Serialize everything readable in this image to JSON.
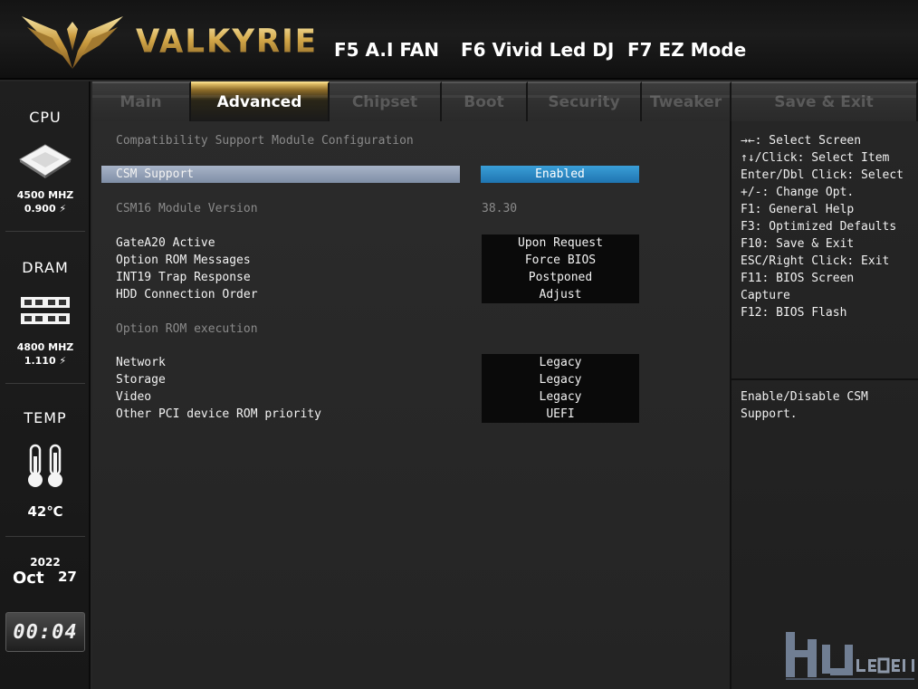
{
  "header": {
    "brand": "VALKYRIE",
    "hotkeys": {
      "f5": "F5 A.I FAN",
      "f6": "F6 Vivid Led DJ",
      "f7": "F7 EZ Mode"
    }
  },
  "sidebar": {
    "cpu": {
      "title": "CPU",
      "freq": "4500 MHZ",
      "volt": "0.900 ⚡"
    },
    "dram": {
      "title": "DRAM",
      "freq": "4800 MHZ",
      "volt": "1.110 ⚡"
    },
    "temp": {
      "title": "TEMP",
      "value": "42℃"
    },
    "date": {
      "year": "2022",
      "month": "Oct",
      "day": "27"
    },
    "time": "00:04"
  },
  "tabs": [
    {
      "label": "Main",
      "active": false
    },
    {
      "label": "Advanced",
      "active": true
    },
    {
      "label": "Chipset",
      "active": false
    },
    {
      "label": "Boot",
      "active": false
    },
    {
      "label": "Security",
      "active": false
    },
    {
      "label": "Tweaker",
      "active": false
    },
    {
      "label": "Save & Exit",
      "active": false
    }
  ],
  "main": {
    "section_title": "Compatibility Support Module Configuration",
    "csm_support": {
      "label": "CSM Support",
      "value": "Enabled"
    },
    "csm16_version": {
      "label": "CSM16 Module Version",
      "value": "38.30"
    },
    "options": [
      {
        "label": "GateA20 Active",
        "value": "Upon Request"
      },
      {
        "label": "Option ROM Messages",
        "value": "Force BIOS"
      },
      {
        "label": "INT19 Trap Response",
        "value": "Postponed"
      },
      {
        "label": "HDD Connection Order",
        "value": "Adjust"
      }
    ],
    "rom_section_title": "Option ROM execution",
    "rom_options": [
      {
        "label": "Network",
        "value": "Legacy"
      },
      {
        "label": "Storage",
        "value": "Legacy"
      },
      {
        "label": "Video",
        "value": "Legacy"
      },
      {
        "label": "Other PCI device ROM priority",
        "value": "UEFI"
      }
    ]
  },
  "help": {
    "keys": [
      "→←: Select Screen",
      "↑↓/Click: Select Item",
      "Enter/Dbl Click: Select",
      "+/-: Change Opt.",
      "F1: General Help",
      "F3: Optimized Defaults",
      "F10: Save & Exit",
      "ESC/Right Click: Exit",
      "F11: BIOS Screen",
      "Capture",
      "F12: BIOS Flash"
    ],
    "description": [
      "Enable/Disable CSM",
      "Support."
    ]
  },
  "colors": {
    "gold": "#d4a849",
    "selected_value": "#2a8cc8",
    "selected_row": "#8e9cb3",
    "value_box": "#0a0a0a",
    "dim_text": "#8a8a8a"
  }
}
